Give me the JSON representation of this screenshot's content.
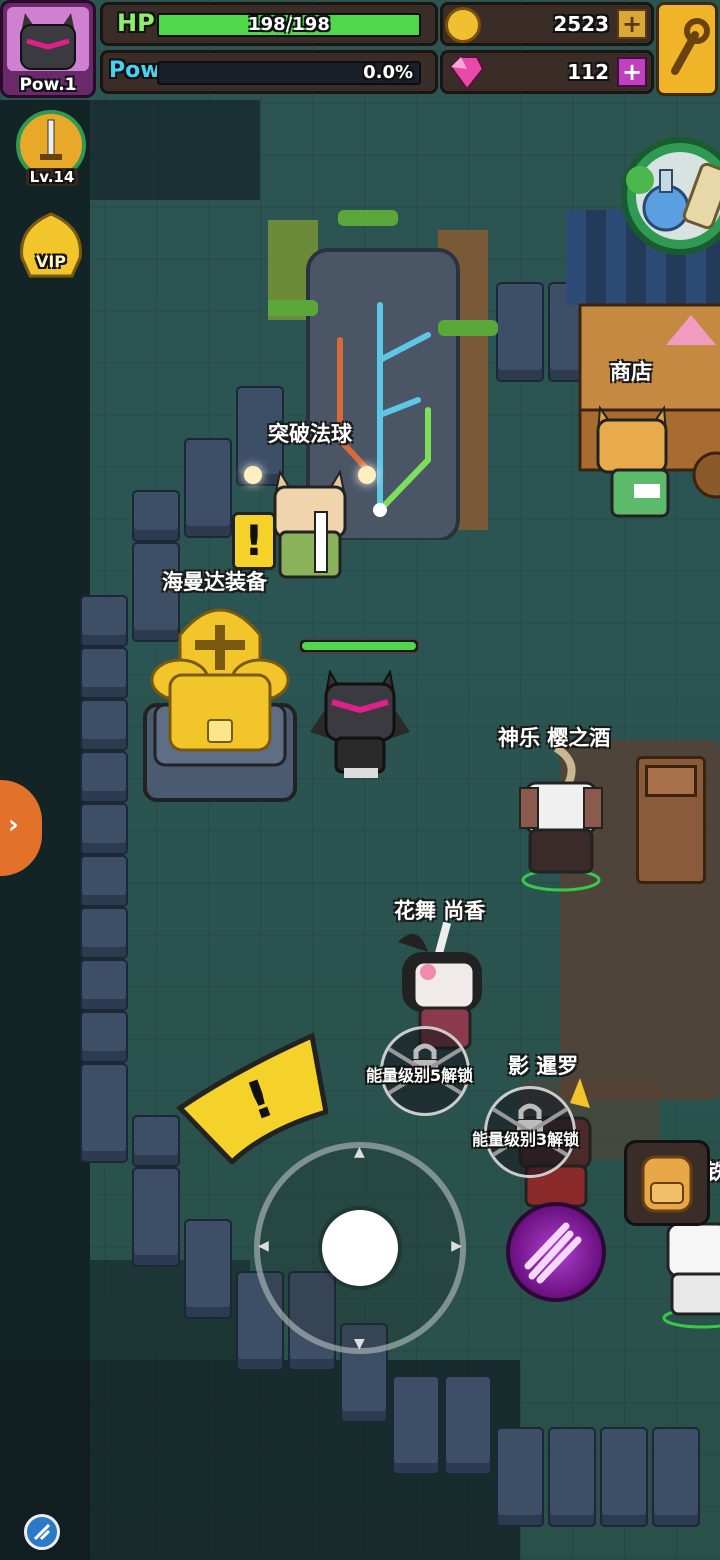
{
  "hud": {
    "player_level": "Pow.1",
    "hp_label": "HP",
    "hp_value": "198/198",
    "hp_fraction": 1.0,
    "pow_label": "Pow",
    "pow_value": "0.0%",
    "pow_fraction": 0.0,
    "gold": "2523",
    "gems": "112",
    "plus": "+",
    "weapon_level": "Lv.14",
    "vip_label": "VIP"
  },
  "world": {
    "orb_label": "突破法球",
    "equip_label": "海曼达装备",
    "shop_label": "商店",
    "npc1": "神乐 樱之酒",
    "npc2": "花舞 尚香",
    "npc3": "影 暹罗",
    "lock1": "能量级别5解锁",
    "lock2": "能量级别3解锁",
    "edge_char": "铁"
  },
  "colors": {
    "hp_fill": "#4fd84a",
    "pow_fill": "#3a7ad6",
    "gold_accent": "#f0c030",
    "gem_accent": "#e040c0"
  }
}
